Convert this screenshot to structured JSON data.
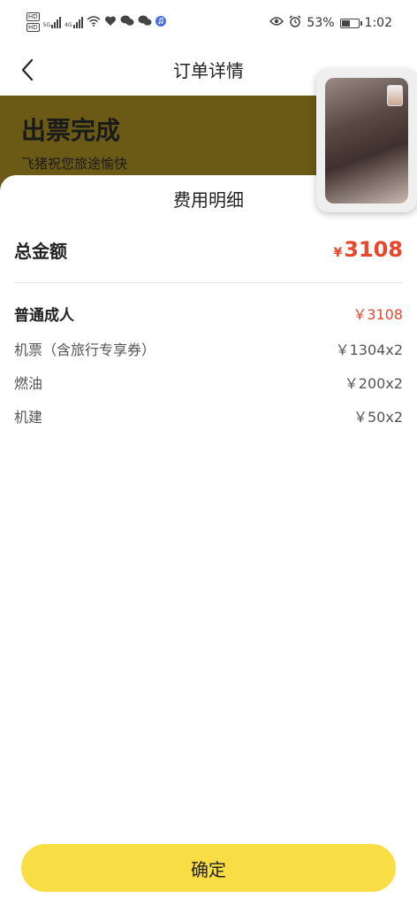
{
  "status_bar": {
    "hd1": "HD",
    "hd2": "HD",
    "net1": "5G",
    "net2": "4G",
    "battery": "53%",
    "battery_level": 0.53,
    "time": "1:02"
  },
  "nav": {
    "title": "订单详情"
  },
  "banner": {
    "title": "出票完成",
    "subtitle": "飞猪祝您旅途愉快"
  },
  "sheet": {
    "title": "费用明细",
    "total_label": "总金额",
    "total_currency": "¥",
    "total_amount": "3108",
    "rows": [
      {
        "label": "普通成人",
        "value": "￥3108"
      },
      {
        "label": "机票（含旅行专享券）",
        "value": "￥1304x2"
      },
      {
        "label": "燃油",
        "value": "￥200x2"
      },
      {
        "label": "机建",
        "value": "￥50x2"
      }
    ],
    "confirm": "确定"
  },
  "colors": {
    "accent": "#e8472c",
    "button": "#f9dd44",
    "banner": "#6b5a15"
  }
}
